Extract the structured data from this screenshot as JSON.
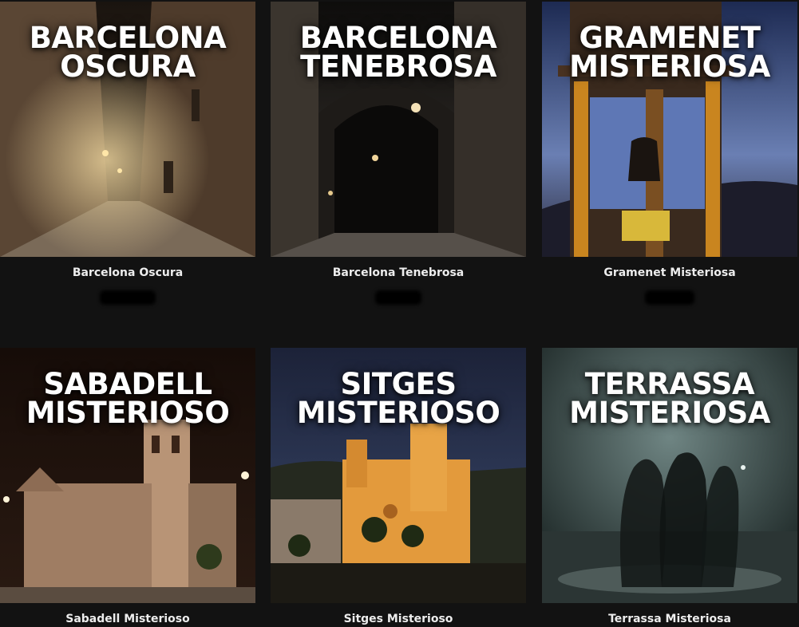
{
  "products": [
    {
      "overlay_line1": "BARCELONA",
      "overlay_line2": "OSCURA",
      "caption": "Barcelona Oscura"
    },
    {
      "overlay_line1": "BARCELONA",
      "overlay_line2": "TENEBROSA",
      "caption": "Barcelona Tenebrosa"
    },
    {
      "overlay_line1": "GRAMENET",
      "overlay_line2": "MISTERIOSA",
      "caption": "Gramenet Misteriosa"
    },
    {
      "overlay_line1": "SABADELL",
      "overlay_line2": "MISTERIOSO",
      "caption": "Sabadell Misterioso"
    },
    {
      "overlay_line1": "SITGES",
      "overlay_line2": "MISTERIOSO",
      "caption": "Sitges Misterioso"
    },
    {
      "overlay_line1": "TERRASSA",
      "overlay_line2": "MISTERIOSA",
      "caption": "Terrassa Misteriosa"
    }
  ]
}
